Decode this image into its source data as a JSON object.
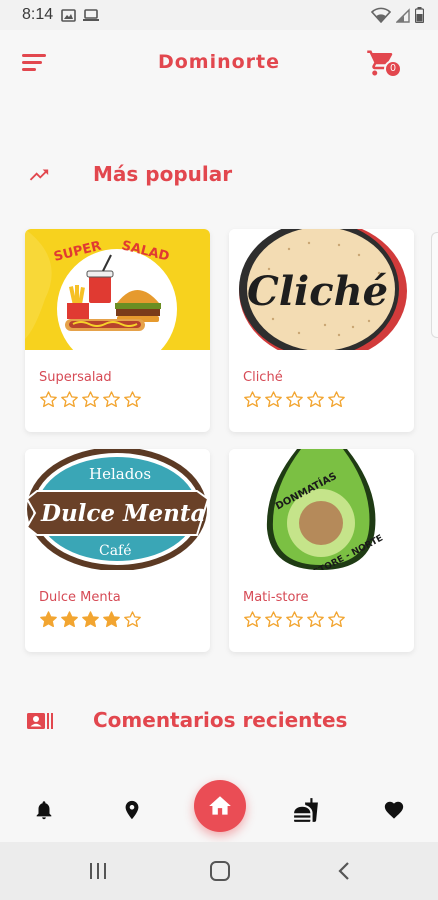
{
  "status_bar": {
    "time": "8:14"
  },
  "app_bar": {
    "title": "Dominorte",
    "cart_count": "0"
  },
  "sections": {
    "popular": {
      "title": "Más popular",
      "icon": "trending-up-icon"
    },
    "recent_comments": {
      "title": "Comentarios recientes",
      "icon": "contact-card-icon"
    }
  },
  "stores": [
    {
      "name": "Supersalad",
      "rating": 0,
      "logo_text": "SUPERSALAD"
    },
    {
      "name": "Cliché",
      "rating": 0,
      "logo_text": "Cliché"
    },
    {
      "name": "Dulce Menta",
      "rating": 4,
      "logo_text": "Dulce Menta",
      "logo_top": "Helados",
      "logo_bottom": "Café"
    },
    {
      "name": "Mati-store",
      "rating": 0,
      "logo_text_top": "DONMATÍAS",
      "logo_text_bottom": "STORE - NORTE"
    }
  ],
  "bottom_nav": [
    "bell-icon",
    "location-pin-icon",
    "home-icon",
    "fastfood-icon",
    "heart-icon"
  ],
  "colors": {
    "accent": "#e2474e",
    "star": "#f2a531",
    "background": "#f7f7f7"
  }
}
